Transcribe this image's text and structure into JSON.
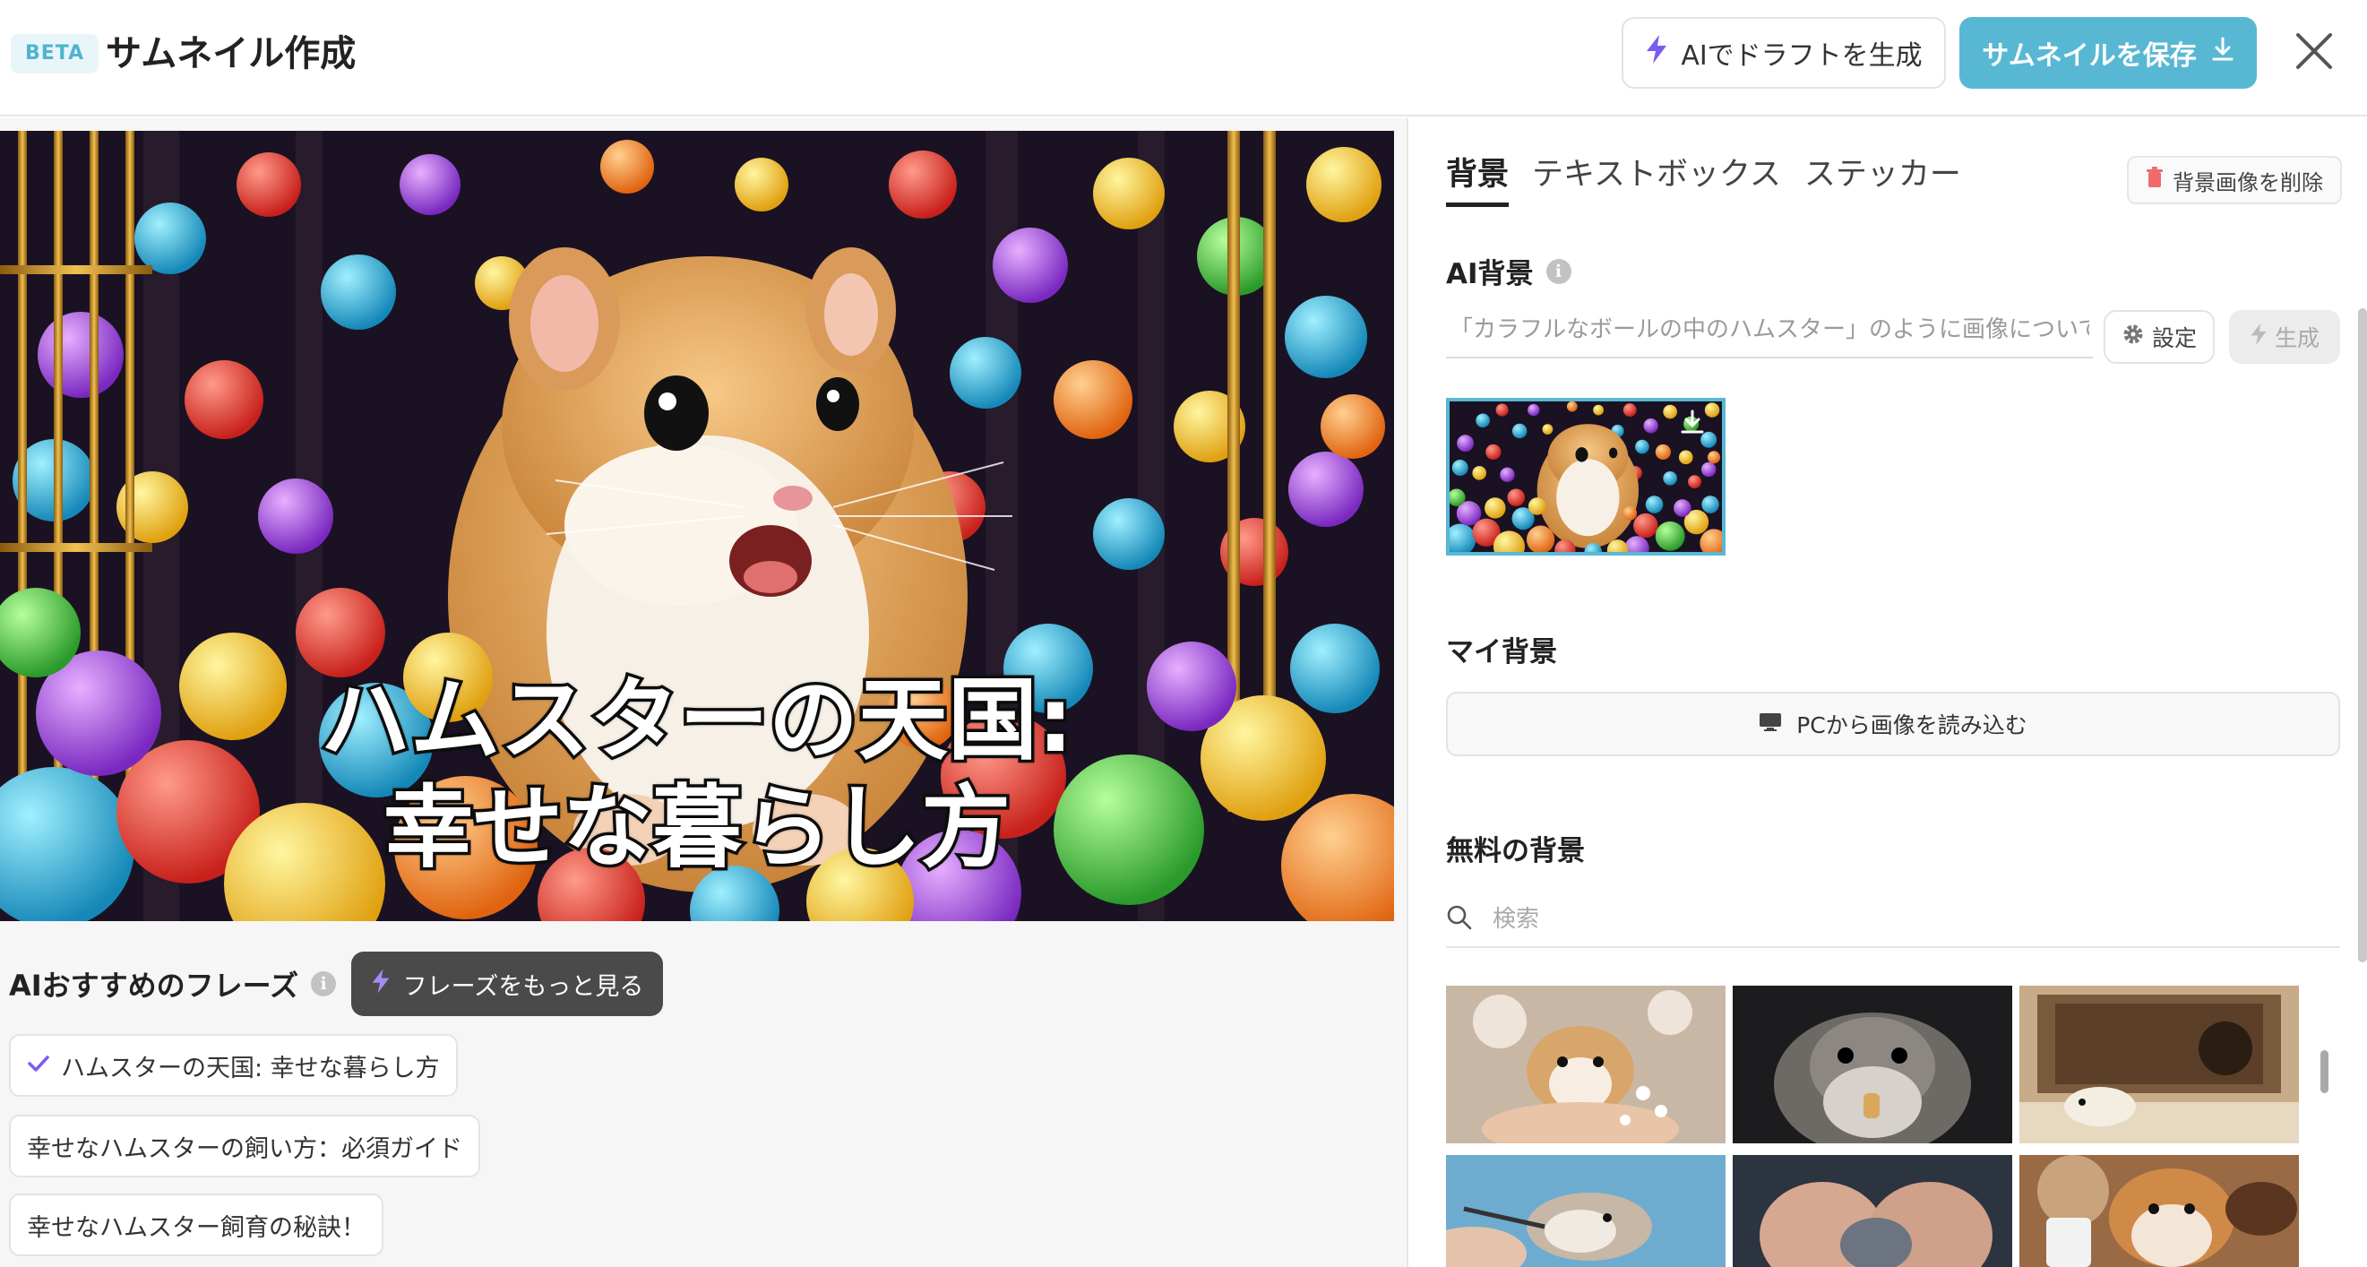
{
  "header": {
    "beta": "BETA",
    "title": "サムネイル作成",
    "draft_button": "AIでドラフトを生成",
    "save_button": "サムネイルを保存"
  },
  "thumbnail": {
    "line1": "ハムスターの天国:",
    "line2": "幸せな暮らし方"
  },
  "phrases": {
    "title": "AIおすすめのフレーズ",
    "more_button": "フレーズをもっと見る",
    "items": [
      "ハムスターの天国: 幸せな暮らし方",
      "幸せなハムスターの飼い方：必須ガイド",
      "幸せなハムスター飼育の秘訣！"
    ]
  },
  "panel": {
    "tabs": [
      "背景",
      "テキストボックス",
      "ステッカー"
    ],
    "delete_bg_button": "背景画像を削除",
    "ai_bg_title": "AI背景",
    "ai_placeholder": "「カラフルなボールの中のハムスター」のように画像について説明してください",
    "settings_button": "設定",
    "generate_button": "生成",
    "my_bg_title": "マイ背景",
    "upload_button": "PCから画像を読み込む",
    "free_bg_title": "無料の背景",
    "search_placeholder": "検索"
  },
  "colors": {
    "accent": "#58b8d3",
    "beta_bg": "#e8f6fa",
    "dark_button": "#4a4a4a",
    "bolt": "#7b5cf0"
  },
  "icons": {
    "draft": "bolt-icon",
    "save": "download-icon",
    "close": "close-icon",
    "info": "info-icon",
    "check": "check-icon",
    "trash": "trash-icon",
    "settings": "gear-icon",
    "generate": "bolt-icon",
    "upload": "monitor-icon",
    "search": "search-icon"
  }
}
